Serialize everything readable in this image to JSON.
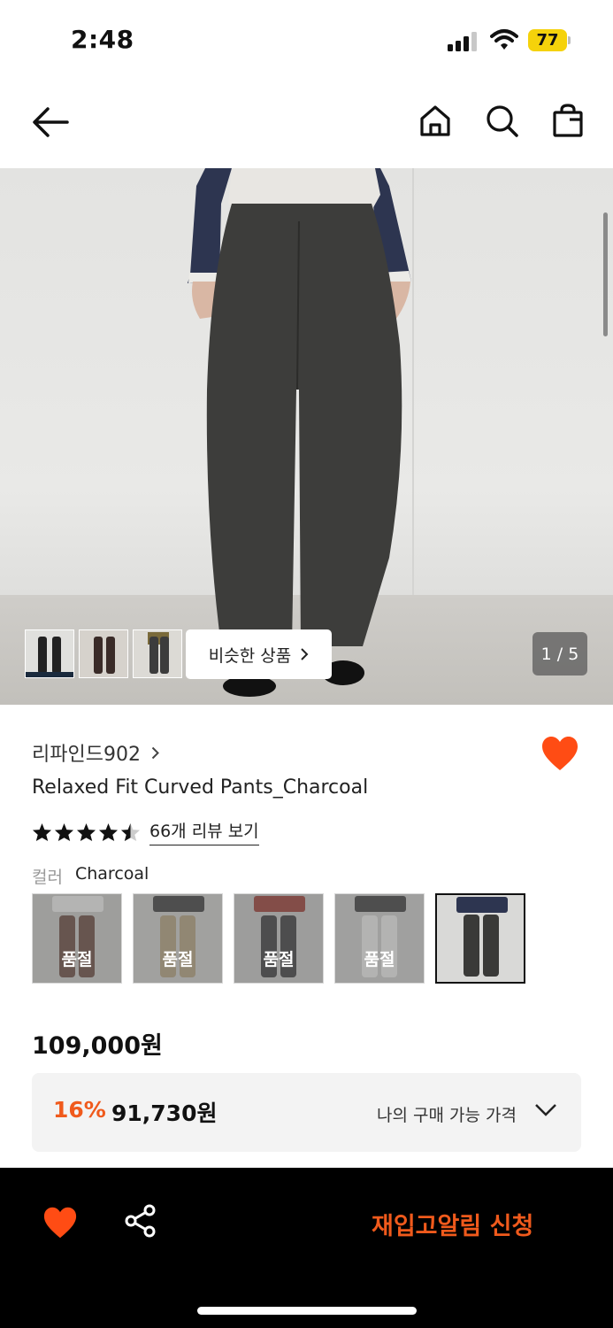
{
  "status_bar": {
    "time": "2:48",
    "battery": "77"
  },
  "nav": {
    "back_icon": "arrow-left-icon",
    "home_icon": "home-icon",
    "search_icon": "search-icon",
    "bag_icon": "shopping-bag-icon"
  },
  "gallery": {
    "similar_label": "비슷한 상품",
    "page_indicator": "1 / 5"
  },
  "product": {
    "brand": "리파인드902",
    "title": "Relaxed Fit Curved Pants_Charcoal",
    "rating": 4.5,
    "review_link": "66개 리뷰 보기",
    "color_label": "컬러",
    "color_value": "Charcoal",
    "swatches": [
      {
        "soldout_label": "품절"
      },
      {
        "soldout_label": "품절"
      },
      {
        "soldout_label": "품절"
      },
      {
        "soldout_label": "품절"
      },
      {
        "soldout_label": ""
      }
    ],
    "price": "109,000원",
    "discount_percent": "16%",
    "discount_price": "91,730원",
    "my_price_label": "나의 구매 가능 가격"
  },
  "bottom_bar": {
    "restock_label": "재입고알림 신청"
  },
  "colors": {
    "accent": "#f05a1c",
    "heart": "#ff4c14",
    "bar_bg": "#000000"
  }
}
